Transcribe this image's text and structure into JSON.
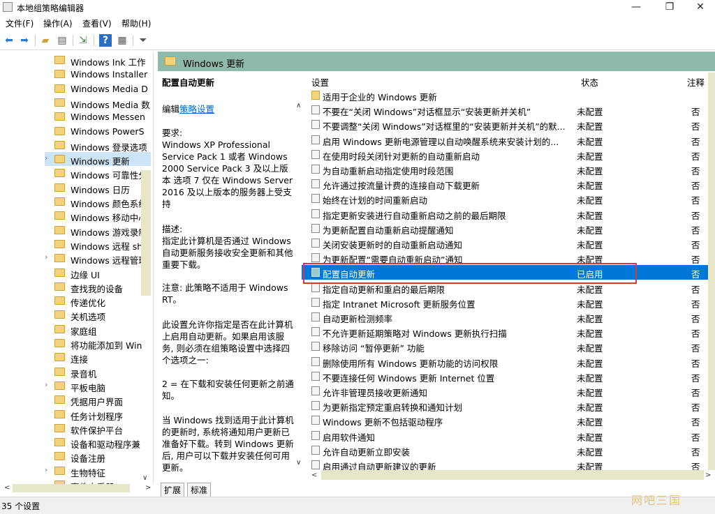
{
  "window": {
    "title": "本地组策略编辑器",
    "minimize": "—",
    "maximize": "❐",
    "close": "✕"
  },
  "menu": [
    "文件(F)",
    "操作(A)",
    "查看(V)",
    "帮助(H)"
  ],
  "toolbar_icons": [
    "back-arrow-icon",
    "forward-arrow-icon",
    "up-folder-icon",
    "show-hide-tree-icon",
    "export-list-icon",
    "help-icon",
    "properties-icon",
    "filter-icon"
  ],
  "tree": {
    "items": [
      {
        "label": "Windows Ink 工作",
        "expandable": false
      },
      {
        "label": "Windows Installer",
        "expandable": false
      },
      {
        "label": "Windows Media D",
        "expandable": false
      },
      {
        "label": "Windows Media 数",
        "expandable": false
      },
      {
        "label": "Windows Messen",
        "expandable": false
      },
      {
        "label": "Windows PowerS",
        "expandable": false
      },
      {
        "label": "Windows 登录选项",
        "expandable": false
      },
      {
        "label": "Windows 更新",
        "expandable": true,
        "selected": true
      },
      {
        "label": "Windows 可靠性分",
        "expandable": false
      },
      {
        "label": "Windows 日历",
        "expandable": false
      },
      {
        "label": "Windows 颜色系统",
        "expandable": false
      },
      {
        "label": "Windows 移动中心",
        "expandable": false
      },
      {
        "label": "Windows 游戏录制",
        "expandable": false
      },
      {
        "label": "Windows 远程 she",
        "expandable": false
      },
      {
        "label": "Windows 远程管理",
        "expandable": true
      },
      {
        "label": "边缘 UI",
        "expandable": false
      },
      {
        "label": "查找我的设备",
        "expandable": false
      },
      {
        "label": "传递优化",
        "expandable": false
      },
      {
        "label": "关机选项",
        "expandable": false
      },
      {
        "label": "家庭组",
        "expandable": false
      },
      {
        "label": "将功能添加到 Win",
        "expandable": false
      },
      {
        "label": "连接",
        "expandable": false
      },
      {
        "label": "录音机",
        "expandable": false
      },
      {
        "label": "平板电脑",
        "expandable": true
      },
      {
        "label": "凭据用户界面",
        "expandable": false
      },
      {
        "label": "任务计划程序",
        "expandable": false
      },
      {
        "label": "软件保护平台",
        "expandable": false
      },
      {
        "label": "设备和驱动程序兼",
        "expandable": false
      },
      {
        "label": "设备注册",
        "expandable": false
      },
      {
        "label": "生物特征",
        "expandable": true
      },
      {
        "label": "事件查看器",
        "expandable": false
      }
    ]
  },
  "pane": {
    "header": "Windows 更新",
    "desc": {
      "title": "配置自动更新",
      "edit_prefix": "编辑",
      "edit_link": "策略设置",
      "req_title": "要求:",
      "req_body": "Windows XP Professional Service Pack 1 或者 Windows 2000 Service Pack 3 及以上版本 选项 7 仅在 Windows Server 2016 及以上版本的服务器上受支持",
      "desc_title": "描述:",
      "desc_body": "指定此计算机是否通过 Windows 自动更新服务接收安全更新和其他重要下载。",
      "note": "注意: 此策略不适用于 Windows RT。",
      "para1": "此设置允许你指定是否在此计算机上启用自动更新。如果启用该服务, 则必须在组策略设置中选择四个选项之一:",
      "para2": "2 = 在下载和安装任何更新之前通知。",
      "para3": "当 Windows 找到适用于此计算机的更新时, 系统将通知用户更新已准备好下载。转到 Windows 更新后, 用户可以下载并安装任何可用更新。"
    },
    "columns": {
      "setting": "设置",
      "state": "状态",
      "note": "注释"
    },
    "rows": [
      {
        "name": "适用于企业的 Windows 更新",
        "state": "",
        "note": "",
        "folder": true
      },
      {
        "name": "不要在“关闭 Windows”对话框显示“安装更新并关机”",
        "state": "未配置",
        "note": "否"
      },
      {
        "name": "不要调整“关闭 Windows”对话框里的“安装更新并关机”的默...",
        "state": "未配置",
        "note": "否"
      },
      {
        "name": "启用 Windows 更新电源管理以自动唤醒系统来安装计划的...",
        "state": "未配置",
        "note": "否"
      },
      {
        "name": "在使用时段关闭针对更新的自动重新启动",
        "state": "未配置",
        "note": "否"
      },
      {
        "name": "为自动重新启动指定使用时段范围",
        "state": "未配置",
        "note": "否"
      },
      {
        "name": "允许通过按流量计费的连接自动下载更新",
        "state": "未配置",
        "note": "否"
      },
      {
        "name": "始终在计划的时间重新启动",
        "state": "未配置",
        "note": "否"
      },
      {
        "name": "指定更新安装进行自动重新启动之前的最后期限",
        "state": "未配置",
        "note": "否"
      },
      {
        "name": "为更新配置自动重新启动提醒通知",
        "state": "未配置",
        "note": "否"
      },
      {
        "name": "关闭安装更新时的自动重新启动通知",
        "state": "未配置",
        "note": "否"
      },
      {
        "name": "为更新配置“需要自动重新启动”通知",
        "state": "未配置",
        "note": "否"
      },
      {
        "name": "配置自动更新",
        "state": "已启用",
        "note": "否",
        "selected": true
      },
      {
        "name": "指定自动更新和重启的最后期限",
        "state": "未配置",
        "note": "否"
      },
      {
        "name": "指定 Intranet Microsoft 更新服务位置",
        "state": "未配置",
        "note": "否"
      },
      {
        "name": "自动更新检测频率",
        "state": "未配置",
        "note": "否"
      },
      {
        "name": "不允许更新延期策略对 Windows 更新执行扫描",
        "state": "未配置",
        "note": "否"
      },
      {
        "name": "移除访问 “暂停更新” 功能",
        "state": "未配置",
        "note": "否"
      },
      {
        "name": "删除使用所有 Windows 更新功能的访问权限",
        "state": "未配置",
        "note": "否"
      },
      {
        "name": "不要连接任何 Windows 更新 Internet 位置",
        "state": "未配置",
        "note": "否"
      },
      {
        "name": "允许非管理员接收更新通知",
        "state": "未配置",
        "note": "否"
      },
      {
        "name": "为更新指定预定重启转换和通知计划",
        "state": "未配置",
        "note": "否"
      },
      {
        "name": "Windows 更新不包括驱动程序",
        "state": "未配置",
        "note": "否"
      },
      {
        "name": "启用软件通知",
        "state": "未配置",
        "note": "否"
      },
      {
        "name": "允许自动更新立即安装",
        "state": "未配置",
        "note": "否"
      },
      {
        "name": "启用通过自动更新建议的更新",
        "state": "未配置",
        "note": "否"
      }
    ],
    "tabs": [
      "扩展",
      "标准"
    ]
  },
  "status": "35 个设置",
  "watermark": "网吧三国"
}
